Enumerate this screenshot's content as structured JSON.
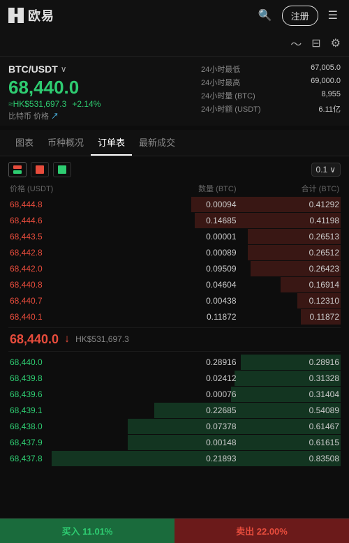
{
  "header": {
    "logo_text": "欧易",
    "register_label": "注册",
    "search_icon": "🔍",
    "menu_icon": "☰"
  },
  "subheader": {
    "chart_icon": "📈",
    "card_icon": "🪪",
    "settings_icon": "⚙️"
  },
  "market": {
    "pair": "BTC/USDT",
    "price": "68,440.0",
    "price_hk": "≈HK$531,697.3",
    "price_change": "+2.14%",
    "sub_label": "比特币 价格",
    "stats": [
      {
        "label": "24小时最低",
        "value": "67,005.0"
      },
      {
        "label": "24小时最高",
        "value": "69,000.0"
      },
      {
        "label": "24小时量 (BTC)",
        "value": "8,955"
      },
      {
        "label": "24小时额 (USDT)",
        "value": "6.11亿"
      }
    ]
  },
  "tabs": [
    {
      "label": "图表",
      "active": false
    },
    {
      "label": "币种概况",
      "active": false
    },
    {
      "label": "订单表",
      "active": true
    },
    {
      "label": "最新成交",
      "active": false
    }
  ],
  "orderbook": {
    "precision": "0.1",
    "col_headers": {
      "price": "价格 (USDT)",
      "qty": "数量 (BTC)",
      "total": "合计 (BTC)"
    },
    "asks": [
      {
        "price": "68,444.8",
        "qty": "0.00094",
        "total": "0.41292",
        "bar": 45
      },
      {
        "price": "68,444.6",
        "qty": "0.14685",
        "total": "0.41198",
        "bar": 44
      },
      {
        "price": "68,443.5",
        "qty": "0.00001",
        "total": "0.26513",
        "bar": 28
      },
      {
        "price": "68,442.8",
        "qty": "0.00089",
        "total": "0.26512",
        "bar": 28
      },
      {
        "price": "68,442.0",
        "qty": "0.09509",
        "total": "0.26423",
        "bar": 27
      },
      {
        "price": "68,440.8",
        "qty": "0.04604",
        "total": "0.16914",
        "bar": 18
      },
      {
        "price": "68,440.7",
        "qty": "0.00438",
        "total": "0.12310",
        "bar": 13
      },
      {
        "price": "68,440.1",
        "qty": "0.11872",
        "total": "0.11872",
        "bar": 12
      }
    ],
    "mid_price": "68,440.0",
    "mid_price_hk": "HK$531,697.3",
    "mid_direction": "↓",
    "bids": [
      {
        "price": "68,440.0",
        "qty": "0.28916",
        "total": "0.28916",
        "bar": 30
      },
      {
        "price": "68,439.8",
        "qty": "0.02412",
        "total": "0.31328",
        "bar": 32
      },
      {
        "price": "68,439.6",
        "qty": "0.00076",
        "total": "0.31404",
        "bar": 33
      },
      {
        "price": "68,439.1",
        "qty": "0.22685",
        "total": "0.54089",
        "bar": 56
      },
      {
        "price": "68,438.0",
        "qty": "0.07378",
        "total": "0.61467",
        "bar": 64
      },
      {
        "price": "68,437.9",
        "qty": "0.00148",
        "total": "0.61615",
        "bar": 64
      },
      {
        "price": "68,437.8",
        "qty": "0.21893",
        "total": "0.83508",
        "bar": 87
      }
    ]
  },
  "bottom": {
    "buy_label": "买入",
    "buy_pct": "11.01%",
    "sell_label": "卖出",
    "sell_pct": "22.00%"
  }
}
